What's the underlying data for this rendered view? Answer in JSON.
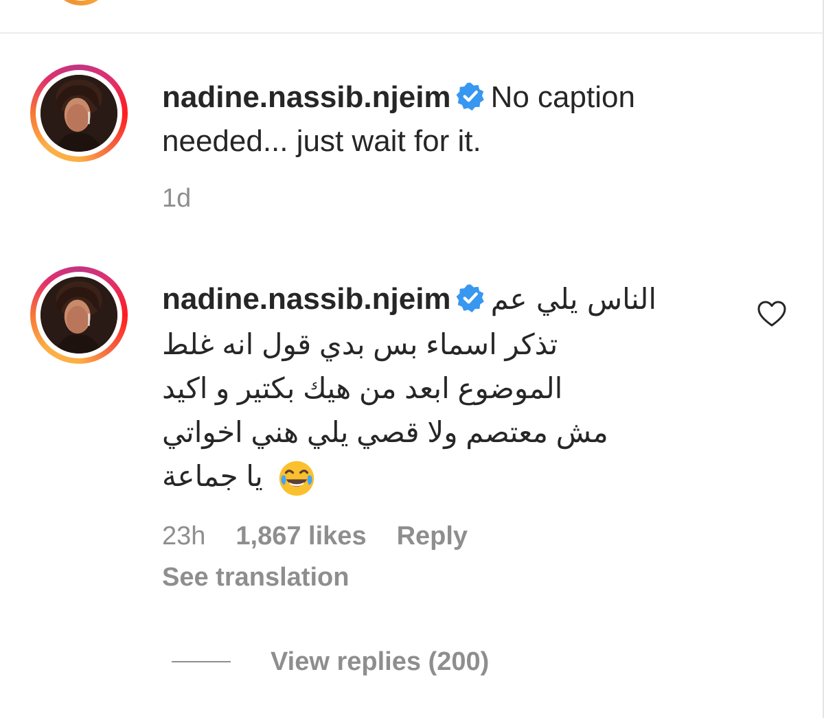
{
  "caption": {
    "username": "nadine.nassib.njeim",
    "text_line1": "No caption",
    "text_line2": "needed... just wait for it.",
    "time": "1d"
  },
  "comment": {
    "username": "nadine.nassib.njeim",
    "first_line": "الناس يلي عم",
    "lines": [
      "تذكر اسماء بس بدي قول انه غلط",
      "الموضوع ابعد من هيك بكتير و اكيد",
      "مش معتصم ولا قصي يلي هني اخواتي",
      "يا جماعة"
    ],
    "emoji": "face-with-tears-of-joy",
    "time": "23h",
    "likes": "1,867 likes",
    "reply_label": "Reply",
    "translation_label": "See translation",
    "view_replies_label": "View replies (200)"
  },
  "icons": {
    "verified": "verified-badge-icon",
    "like": "heart-icon"
  },
  "colors": {
    "verified_blue": "#3897f0",
    "text": "#262626",
    "muted": "#8e8e8e"
  }
}
